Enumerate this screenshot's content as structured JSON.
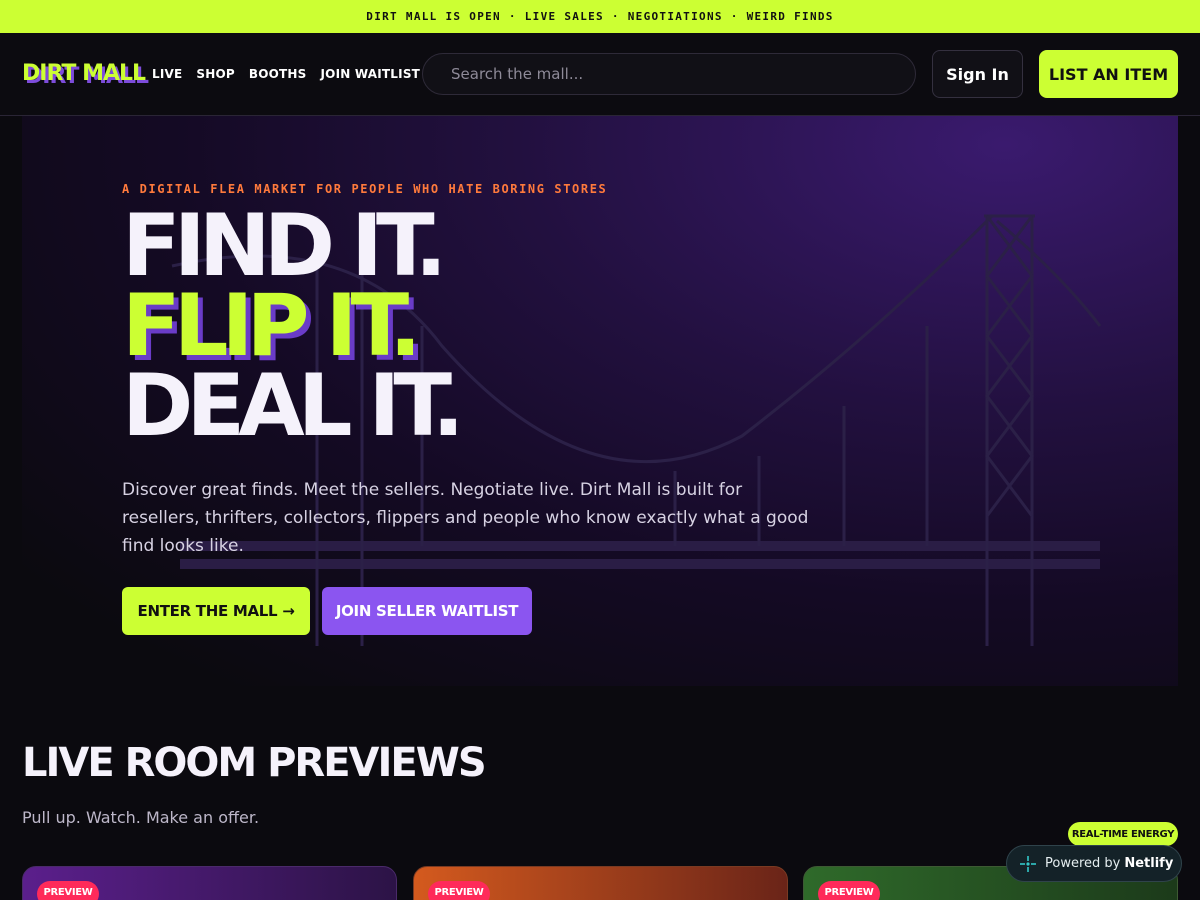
{
  "announcement": "DIRT MALL IS OPEN · LIVE SALES · NEGOTIATIONS · WEIRD FINDS",
  "header": {
    "logo": "DIRT MALL",
    "nav": [
      "LIVE",
      "SHOP",
      "BOOTHS",
      "JOIN WAITLIST"
    ],
    "search_placeholder": "Search the mall...",
    "signin_label": "Sign In",
    "list_item_label": "LIST AN ITEM"
  },
  "hero": {
    "eyebrow": "A DIGITAL FLEA MARKET FOR PEOPLE WHO HATE BORING STORES",
    "line1": "FIND IT.",
    "line2": "FLIP IT.",
    "line3": "DEAL IT.",
    "copy": "Discover great finds. Meet the sellers. Negotiate live. Dirt Mall is built for resellers, thrifters, collectors, flippers and people who know exactly what a good find looks like.",
    "enter_label": "ENTER THE MALL →",
    "waitlist_label": "JOIN SELLER WAITLIST"
  },
  "live": {
    "title": "LIVE ROOM PREVIEWS",
    "subtitle": "Pull up. Watch. Make an offer.",
    "energy_badge": "REAL-TIME ENERGY",
    "cards": [
      {
        "badge": "PREVIEW"
      },
      {
        "badge": "PREVIEW"
      },
      {
        "badge": "PREVIEW"
      }
    ]
  },
  "netlify": {
    "prefix": "Powered by",
    "brand": "Netlify"
  },
  "colors": {
    "accent_lime": "#ccff33",
    "accent_purple": "#8b55f0",
    "eyebrow_orange": "#ff7a3c",
    "badge_pink": "#ff2a5a"
  },
  "icons": {
    "netlify": "netlify-logo-icon"
  }
}
